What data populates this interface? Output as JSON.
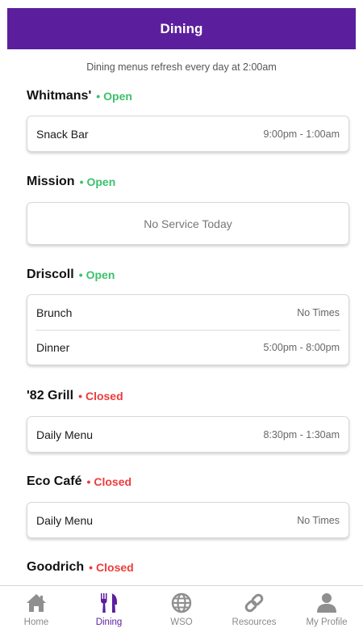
{
  "header": {
    "title": "Dining"
  },
  "notice": "Dining menus refresh every day at 2:00am",
  "colors": {
    "accent": "#5b1f9e",
    "open": "#3cc16b",
    "closed": "#ef3b3b"
  },
  "halls": [
    {
      "name": "Whitmans'",
      "status": "Open",
      "meals": [
        {
          "name": "Snack Bar",
          "time": "9:00pm - 1:00am"
        }
      ]
    },
    {
      "name": "Mission",
      "status": "Open",
      "no_service": "No Service Today"
    },
    {
      "name": "Driscoll",
      "status": "Open",
      "meals": [
        {
          "name": "Brunch",
          "time": "No Times"
        },
        {
          "name": "Dinner",
          "time": "5:00pm - 8:00pm"
        }
      ]
    },
    {
      "name": "'82 Grill",
      "status": "Closed",
      "meals": [
        {
          "name": "Daily Menu",
          "time": "8:30pm - 1:30am"
        }
      ]
    },
    {
      "name": "Eco Café",
      "status": "Closed",
      "meals": [
        {
          "name": "Daily Menu",
          "time": "No Times"
        }
      ]
    },
    {
      "name": "Goodrich",
      "status": "Closed"
    }
  ],
  "tabs": [
    {
      "label": "Home",
      "icon": "home-icon"
    },
    {
      "label": "Dining",
      "icon": "fork-knife-icon"
    },
    {
      "label": "WSO",
      "icon": "globe-icon"
    },
    {
      "label": "Resources",
      "icon": "link-icon"
    },
    {
      "label": "My Profile",
      "icon": "user-icon"
    }
  ]
}
